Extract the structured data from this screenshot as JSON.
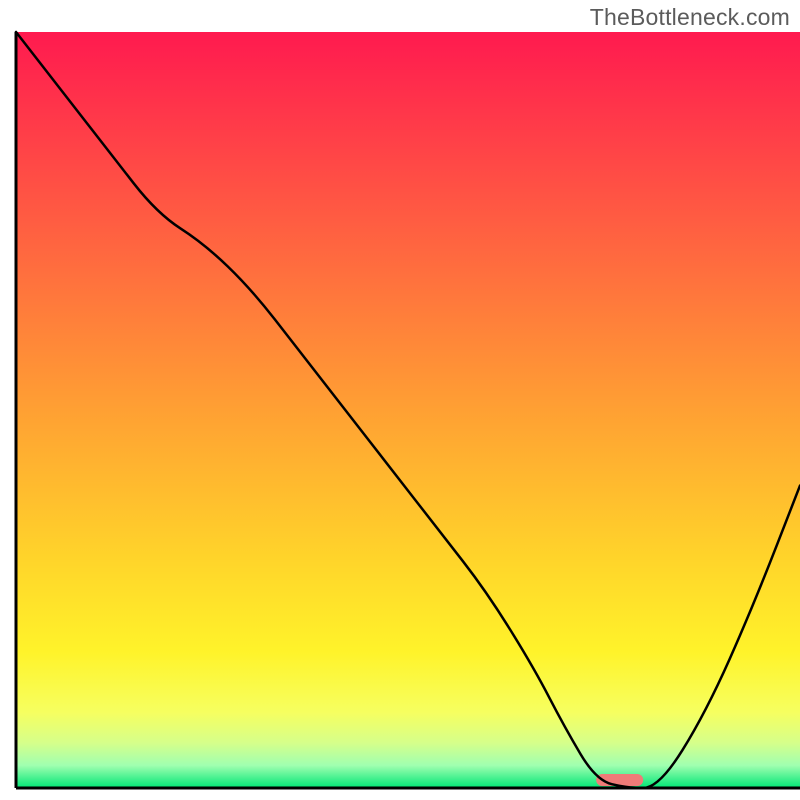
{
  "watermark": "TheBottleneck.com",
  "chart_data": {
    "type": "line",
    "title": "",
    "xlabel": "",
    "ylabel": "",
    "xlim": [
      0,
      100
    ],
    "ylim": [
      0,
      100
    ],
    "background_gradient": {
      "stops": [
        {
          "offset": 0.0,
          "color": "#ff1a4f"
        },
        {
          "offset": 0.12,
          "color": "#ff3a49"
        },
        {
          "offset": 0.3,
          "color": "#ff6a3f"
        },
        {
          "offset": 0.5,
          "color": "#ffa033"
        },
        {
          "offset": 0.7,
          "color": "#ffd52a"
        },
        {
          "offset": 0.82,
          "color": "#fff32a"
        },
        {
          "offset": 0.9,
          "color": "#f6ff60"
        },
        {
          "offset": 0.94,
          "color": "#d6ff8a"
        },
        {
          "offset": 0.97,
          "color": "#a0ffb0"
        },
        {
          "offset": 1.0,
          "color": "#00e676"
        }
      ]
    },
    "series": [
      {
        "name": "bottleneck-curve",
        "type": "line",
        "stroke": "#000000",
        "x": [
          0,
          6,
          12,
          18,
          24,
          30,
          36,
          42,
          48,
          54,
          60,
          66,
          70,
          74,
          78,
          82,
          88,
          94,
          100
        ],
        "y": [
          100,
          92,
          84,
          76,
          72,
          66,
          58,
          50,
          42,
          34,
          26,
          16,
          8,
          1,
          0,
          0,
          10,
          24,
          40
        ]
      }
    ],
    "marker": {
      "name": "optimal-range",
      "x_center": 77,
      "y": 0,
      "width_pct": 6,
      "color": "#ef7b78"
    }
  },
  "colors": {
    "axis": "#000000"
  }
}
